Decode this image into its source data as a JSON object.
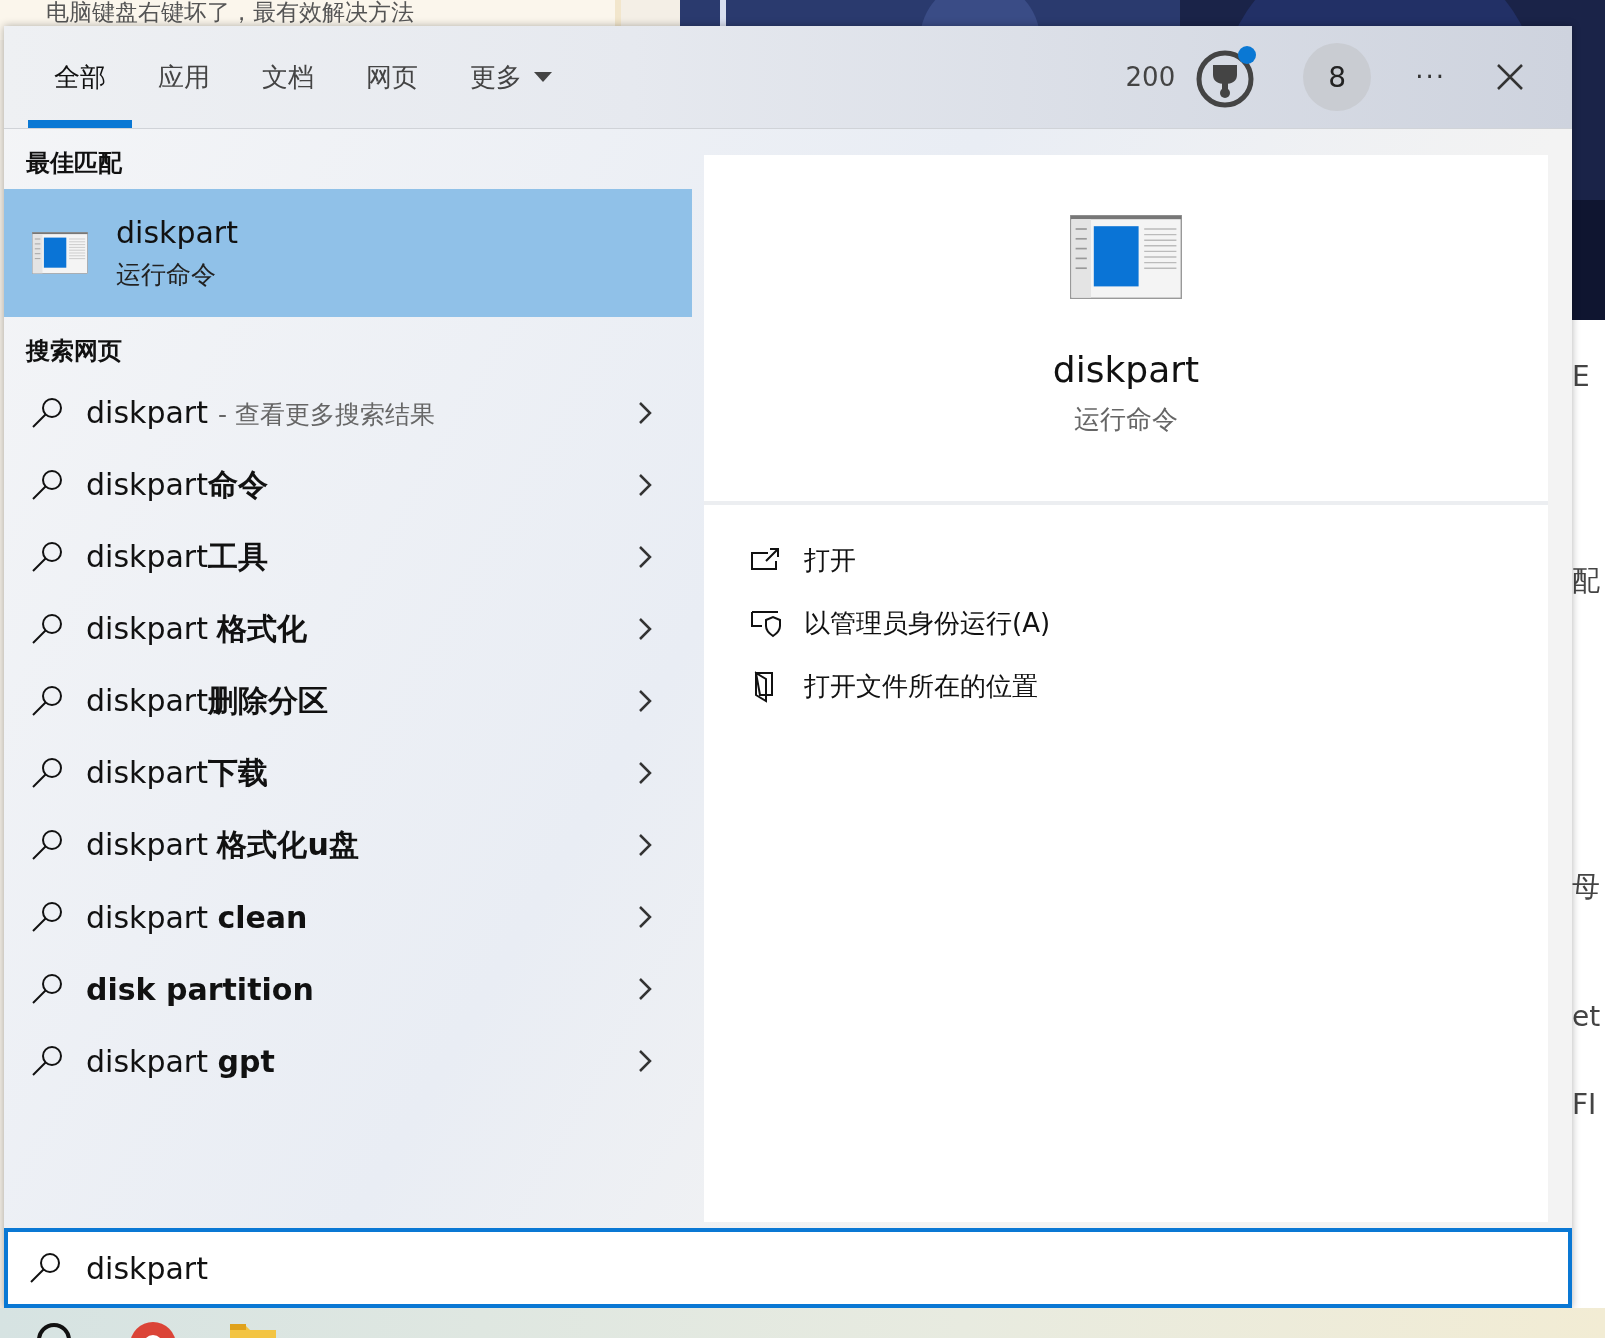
{
  "background_page": {
    "headline": "电脑键盘右键坏了，最有效解决方法",
    "edge_texts": [
      "E",
      "配",
      "母",
      "et",
      "FI"
    ]
  },
  "tabs": [
    {
      "label": "全部",
      "selected": true
    },
    {
      "label": "应用",
      "selected": false
    },
    {
      "label": "文档",
      "selected": false
    },
    {
      "label": "网页",
      "selected": false
    },
    {
      "label": "更多",
      "selected": false,
      "kind": "dropdown"
    }
  ],
  "header": {
    "points": "200",
    "has_notification": true,
    "avatar": "8",
    "more": "···"
  },
  "best_match": {
    "heading": "最佳匹配",
    "title": "diskpart",
    "subtitle": "运行命令",
    "selected": true
  },
  "web_search": {
    "heading": "搜索网页",
    "items": [
      {
        "text": "diskpart",
        "hint": "- 查看更多搜索结果"
      },
      {
        "text": "diskpart**命令**"
      },
      {
        "text": "diskpart**工具**"
      },
      {
        "text": "diskpart **格式化**"
      },
      {
        "text": "diskpart**删除分区**"
      },
      {
        "text": "diskpart**下载**"
      },
      {
        "text": "diskpart **格式化u盘**"
      },
      {
        "text": "diskpart **clean**"
      },
      {
        "text": "**disk partition**"
      },
      {
        "text": "diskpart **gpt**"
      }
    ]
  },
  "preview": {
    "title": "diskpart",
    "subtitle": "运行命令",
    "actions": [
      {
        "label": "打开",
        "kind": "open"
      },
      {
        "label": "以管理员身份运行(A)",
        "kind": "admin"
      },
      {
        "label": "打开文件所在的位置",
        "kind": "folder"
      }
    ]
  },
  "search_box": {
    "value": "diskpart",
    "focused": true
  }
}
